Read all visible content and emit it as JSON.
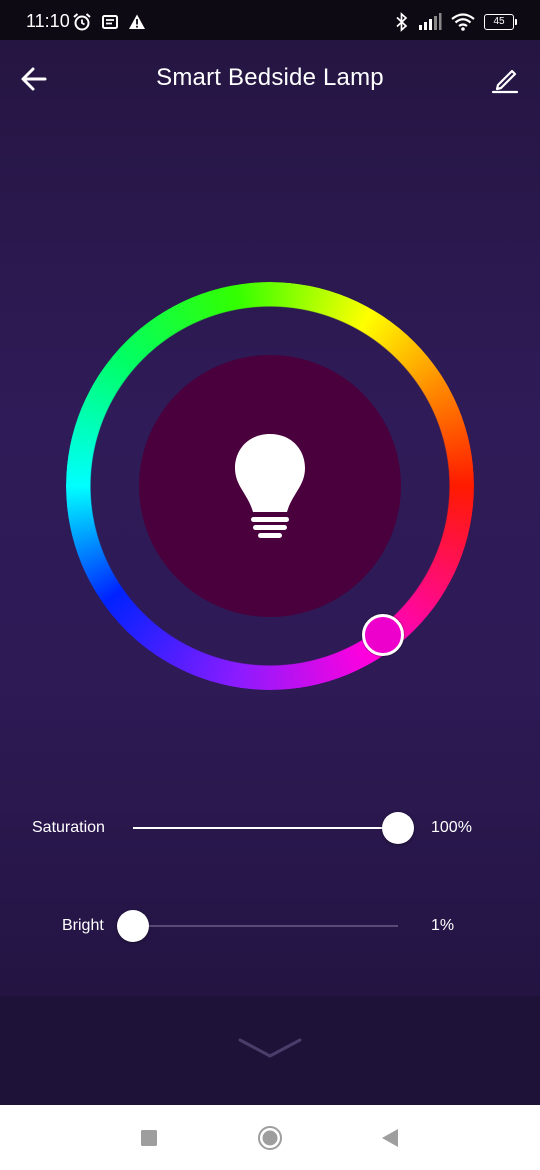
{
  "status_bar": {
    "time": "11:10",
    "battery": "45",
    "left_icons": [
      "alarm-icon",
      "notification-icon",
      "warning-icon"
    ],
    "right_icons": [
      "bluetooth-icon",
      "signal-icon",
      "wifi-icon",
      "battery-icon"
    ]
  },
  "header": {
    "title": "Smart Bedside Lamp",
    "back_icon": "arrow-back-icon",
    "edit_icon": "pencil-icon"
  },
  "color_wheel": {
    "selected_color": "#ee00cc",
    "preview_color": "#4a003d"
  },
  "saturation": {
    "label": "Saturation",
    "value_text": "100%",
    "value": 1.0
  },
  "brightness": {
    "label": "Bright",
    "value_text": "1%",
    "value": 0.0
  },
  "footer": {
    "collapse_icon": "chevron-down-icon"
  },
  "nav_bar": {
    "buttons": [
      "recents-button",
      "home-button",
      "back-button"
    ]
  }
}
